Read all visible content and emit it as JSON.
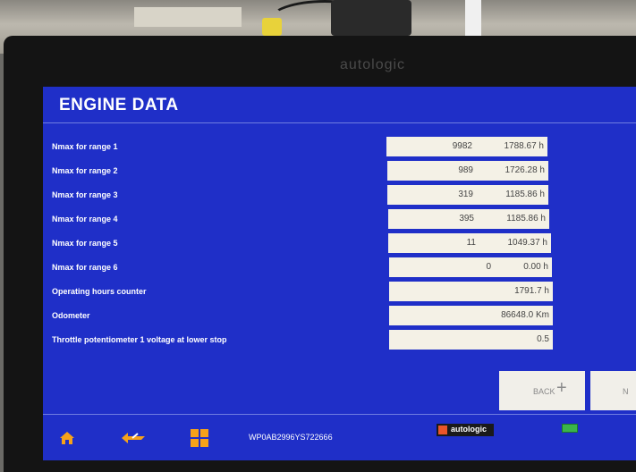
{
  "device_brand": "autologic",
  "screen": {
    "title": "ENGINE DATA",
    "rows": [
      {
        "label": "Nmax for range 1",
        "count": "9982",
        "hours": "1788.67 h"
      },
      {
        "label": "Nmax for range 2",
        "count": "989",
        "hours": "1726.28 h"
      },
      {
        "label": "Nmax for range 3",
        "count": "319",
        "hours": "1185.86 h"
      },
      {
        "label": "Nmax for range 4",
        "count": "395",
        "hours": "1185.86 h"
      },
      {
        "label": "Nmax for range 5",
        "count": "11",
        "hours": "1049.37 h"
      },
      {
        "label": "Nmax for range 6",
        "count": "0",
        "hours": "0.00 h"
      },
      {
        "label": "Operating hours counter",
        "count": "",
        "hours": "1791.7 h"
      },
      {
        "label": "Odometer",
        "count": "",
        "hours": "86648.0 Km"
      },
      {
        "label": "Throttle potentiometer 1 voltage at lower stop",
        "count": "",
        "hours": "0.5"
      }
    ],
    "buttons": {
      "back": "BACK",
      "next": "N"
    },
    "footer": {
      "vin": "WP0AB2996YS722666",
      "logo_text": "autologic"
    }
  },
  "colors": {
    "screen_bg": "#1f2fc8",
    "value_box": "#f4f1e6",
    "accent_orange": "#f6a21a"
  }
}
